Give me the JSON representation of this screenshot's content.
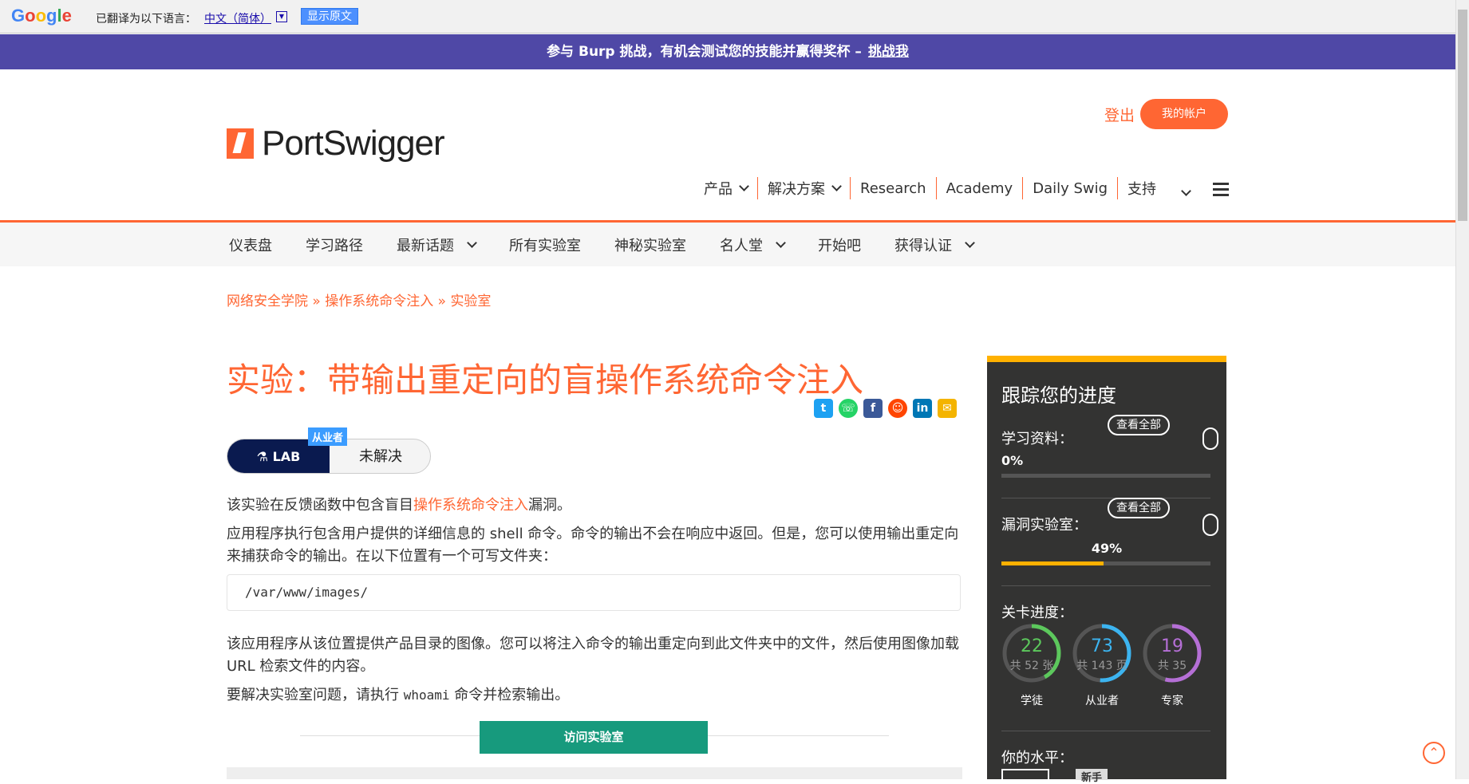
{
  "translate_bar": {
    "logo": "Google",
    "translated_to": "已翻译为以下语言：",
    "language": "中文（简体）",
    "show_original": "显示原文"
  },
  "promo": {
    "text": "参与 Burp 挑战，有机会测试您的技能并赢得奖杯 –",
    "link": "挑战我"
  },
  "header": {
    "brand": "PortSwigger",
    "login": "登出",
    "account": "我的帐户",
    "nav": [
      "产品",
      "解决方案",
      "Research",
      "Academy",
      "Daily Swig",
      "支持"
    ]
  },
  "subnav": [
    "仪表盘",
    "学习路径",
    "最新话题",
    "所有实验室",
    "神秘实验室",
    "名人堂",
    "开始吧",
    "获得认证"
  ],
  "breadcrumb": [
    "网络安全学院",
    "操作系统命令注入",
    "实验室"
  ],
  "title": "实验：带输出重定向的盲操作系统命令注入",
  "lab": {
    "badge": "LAB",
    "status": "未解决",
    "level": "从业者"
  },
  "content": {
    "p1_pre": "该实验在反馈函数中包含盲目",
    "p1_link": "操作系统命令注入",
    "p1_post": "漏洞。",
    "p2": "应用程序执行包含用户提供的详细信息的 shell 命令。命令的输出不会在响应中返回。但是，您可以使用输出重定向来捕获命令的输出。在以下位置有一个可写文件夹：",
    "code": "/var/www/images/",
    "p3": "该应用程序从该位置提供产品目录的图像。您可以将注入命令的输出重定向到此文件夹中的文件，然后使用图像加载 URL 检索文件的内容。",
    "p4_pre": "要解决实验室问题，请执行 ",
    "p4_code": "whoami",
    "p4_post": " 命令并检索输出。",
    "access_button": "访问实验室"
  },
  "progress": {
    "title": "跟踪您的进度",
    "learning_label": "学习资料：",
    "learning_pct": "0%",
    "learning_value": 0,
    "labs_label": "漏洞实验室：",
    "labs_pct": "49%",
    "labs_value": 49,
    "view_all": "查看全部",
    "level_progress": "关卡进度：",
    "rings": [
      {
        "num": "22",
        "sub": "共 52 张",
        "label": "学徒",
        "color": "#5cc85c",
        "fraction": 0.42
      },
      {
        "num": "73",
        "sub": "共 143 页",
        "label": "从业者",
        "color": "#3cb4f0",
        "fraction": 0.51
      },
      {
        "num": "19",
        "sub": "共 35",
        "label": "专家",
        "color": "#b56fd6",
        "fraction": 0.54
      }
    ],
    "your_level": "你的水平：",
    "level_tag": "新手"
  },
  "colors": {
    "accent": "#ff6633",
    "promo": "#4f48a6",
    "lab_dark": "#0a1a4f",
    "access_green": "#179a7d",
    "panel": "#333332",
    "panel_accent": "#ffb100"
  }
}
